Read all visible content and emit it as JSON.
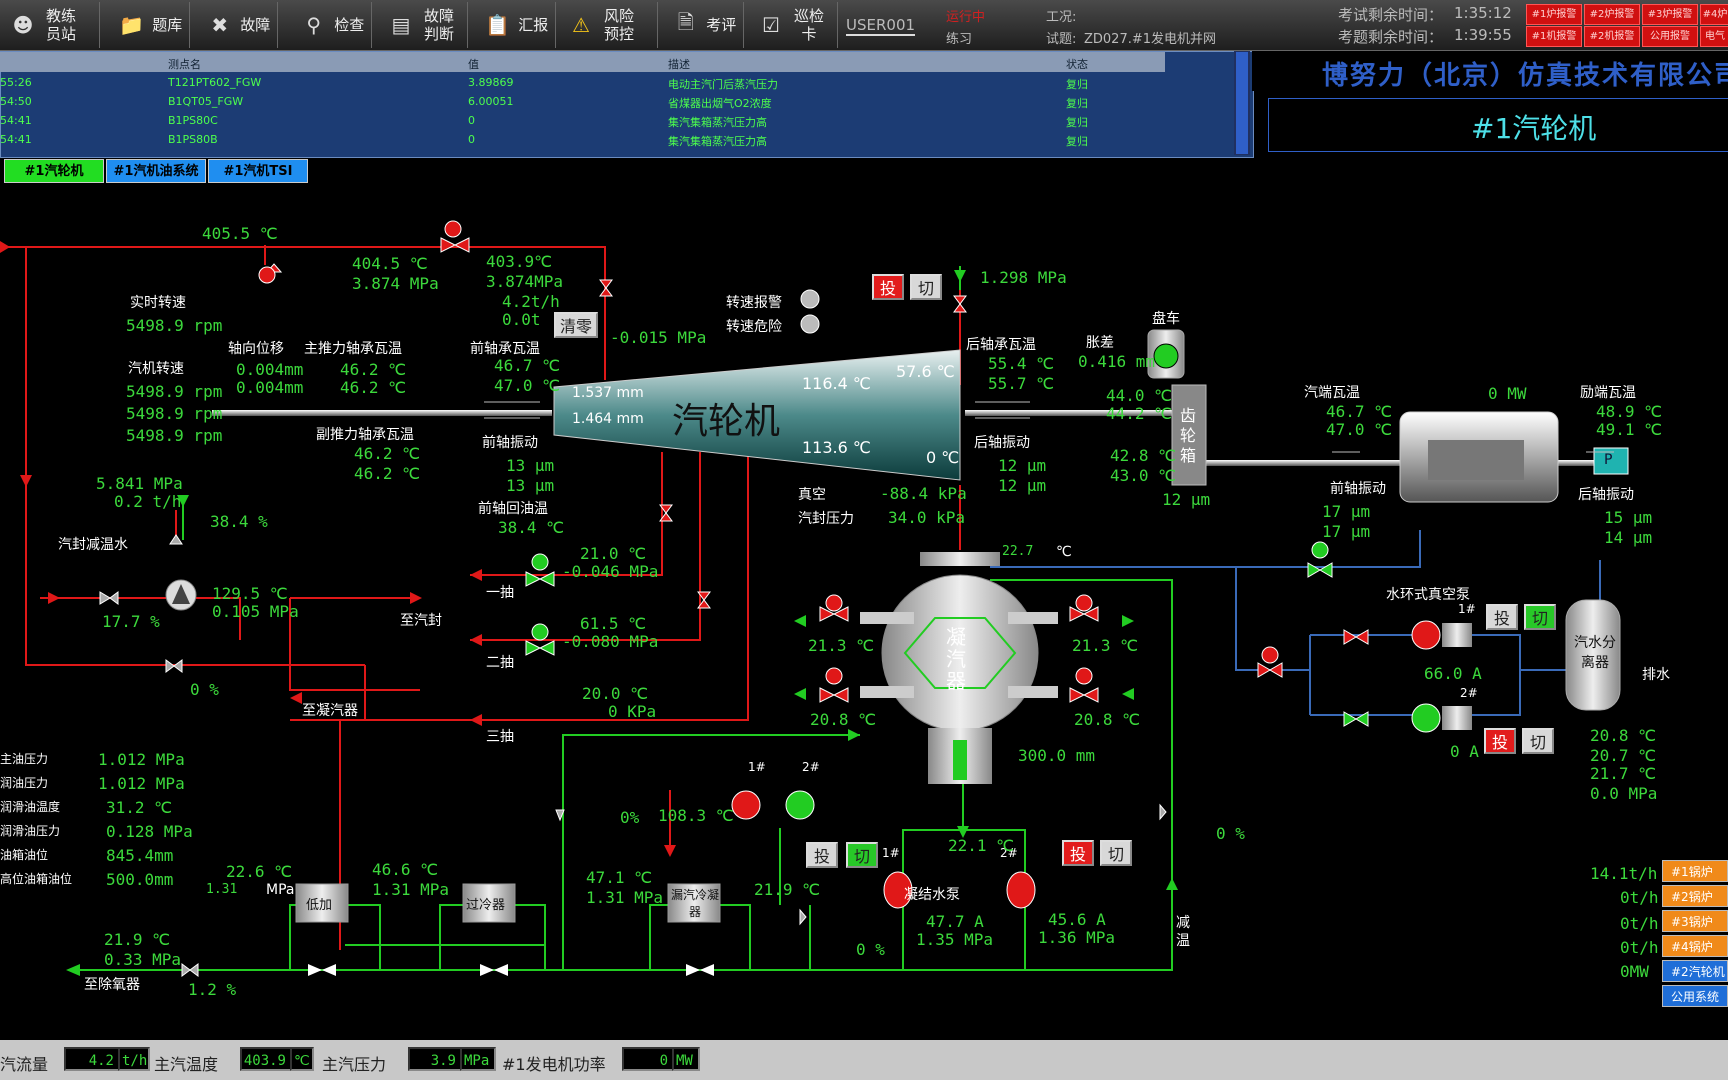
{
  "toolbar": {
    "buttons": [
      {
        "label": "教练员站",
        "icon": "user-icon"
      },
      {
        "label": "题库",
        "icon": "folder-icon"
      },
      {
        "label": "故障",
        "icon": "tools-icon"
      },
      {
        "label": "检查",
        "icon": "magnifier-icon"
      },
      {
        "label": "故障判断",
        "icon": "monitor-icon"
      },
      {
        "label": "汇报",
        "icon": "clipboard-icon"
      },
      {
        "label": "风险预控",
        "icon": "warning-icon"
      },
      {
        "label": "考评",
        "icon": "document-icon"
      },
      {
        "label": "巡检卡",
        "icon": "checklist-icon"
      }
    ],
    "user": "USER001",
    "mode_status": "运行中",
    "mode": "练习",
    "condition_label": "工况:",
    "exam_label": "试题:",
    "exam_name": "ZD027.#1发电机并网",
    "exam_remaining_label": "考试剩余时间：",
    "exam_remaining": "1:35:12",
    "question_remaining_label": "考题剩余时间：",
    "question_remaining": "1:39:55",
    "alarm_buttons": [
      "#1炉报警",
      "#2炉报警",
      "#3炉报警",
      "#4炉",
      "#1机报警",
      "#2机报警",
      "公用报警",
      "电气"
    ]
  },
  "alarm_table": {
    "headers": [
      "测点名",
      "值",
      "描述",
      "状态"
    ],
    "rows": [
      {
        "time": "55:26",
        "point": "T121PT602_FGW",
        "value": "3.89869",
        "desc": "电动主汽门后蒸汽压力",
        "state": "复归"
      },
      {
        "time": "54:50",
        "point": "B1QT05_FGW",
        "value": "6.00051",
        "desc": "省煤器出烟气O2浓度",
        "state": "复归"
      },
      {
        "time": "54:41",
        "point": "B1PS80C",
        "value": "0",
        "desc": "集汽集箱蒸汽压力高",
        "state": "复归"
      },
      {
        "time": "54:41",
        "point": "B1PS80B",
        "value": "0",
        "desc": "集汽集箱蒸汽压力高",
        "state": "复归"
      }
    ]
  },
  "company": "博努力（北京）仿真技术有限公司",
  "page_title": "#1汽轮机",
  "tabs": [
    "#1汽轮机",
    "#1汽机油系统",
    "#1汽机TSI"
  ],
  "main_steam": {
    "temp1": "405.5 ℃",
    "temp2": "404.5  ℃",
    "pressure": "3.874  MPa"
  },
  "steam_in": {
    "temp": "403.9℃",
    "pressure": "3.874MPa",
    "flow": "4.2t/h",
    "total": "0.0t",
    "clear_label": "清零",
    "valve_pressure": "-0.015 MPa"
  },
  "speed": {
    "realtime_label": "实时转速",
    "realtime": "5498.9 rpm",
    "turbine_label": "汽机转速",
    "turbine": [
      "5498.9 rpm",
      "5498.9 rpm",
      "5498.9 rpm"
    ],
    "alarm_label": "转速报警",
    "danger_label": "转速危险"
  },
  "axial": {
    "label": "轴向位移",
    "values": [
      "0.004mm",
      "0.004mm"
    ]
  },
  "main_thrust": {
    "label": "主推力轴承瓦温",
    "values": [
      "46.2 ℃",
      "46.2 ℃"
    ]
  },
  "aux_thrust": {
    "label": "副推力轴承瓦温",
    "values": [
      "46.2 ℃",
      "46.2 ℃"
    ]
  },
  "front_bearing": {
    "label": "前轴承瓦温",
    "values": [
      "46.7 ℃",
      "47.0 ℃"
    ],
    "vib_label": "前轴振动",
    "vib": [
      "13 μm",
      "13 μm"
    ],
    "return_label": "前轴回油温",
    "return": "38.4 ℃"
  },
  "turbine": {
    "name": "汽轮机",
    "inlet_mm": [
      "1.537 mm",
      "1.464 mm"
    ],
    "temp_top": "116.4 ℃",
    "temp_bottom": "113.6 ℃",
    "exhaust_top": "57.6 ℃",
    "exhaust_bottom": "0 ℃"
  },
  "rear_bearing": {
    "label": "后轴承瓦温",
    "values": [
      "55.4 ℃",
      "55.7 ℃"
    ],
    "vib_label": "后轴振动",
    "vib": [
      "12 μm",
      "12 μm"
    ]
  },
  "exhaust_pressure": "1.298 MPa",
  "diff_expansion": {
    "label": "胀差",
    "value": "0.416 mm"
  },
  "turning_gear": {
    "label": "盘车"
  },
  "gearbox": {
    "label": "齿轮箱",
    "temps_top": [
      "44.0 ℃",
      "44.2 ℃"
    ],
    "temps_bottom": [
      "42.8 ℃",
      "43.0 ℃"
    ],
    "vib": "12 μm"
  },
  "generator": {
    "power": "0 MW",
    "bearing_label": "汽端瓦温",
    "bearing": [
      "46.7 ℃",
      "47.0 ℃"
    ],
    "front_vib_label": "前轴振动",
    "front_vib": [
      "17 μm",
      "17 μm"
    ],
    "exciter_label": "励端瓦温",
    "exciter": [
      "48.9 ℃",
      "49.1 ℃"
    ],
    "rear_vib_label": "后轴振动",
    "rear_vib": [
      "15 μm",
      "14 μm"
    ],
    "p_label": "P"
  },
  "vacuum": {
    "label": "真空",
    "value": "-88.4 kPa",
    "seal_label": "汽封压力",
    "seal": "34.0 kPa"
  },
  "condenser": {
    "label": "凝汽器",
    "temp": "22.7",
    "temp_unit": "℃",
    "level": "300.0 mm",
    "cw_left": [
      "21.3 ℃",
      "20.8 ℃"
    ],
    "cw_right": [
      "21.3 ℃",
      "20.8 ℃"
    ]
  },
  "gland": {
    "label": "汽封减温水",
    "pressure": "5.841 MPa",
    "flow": "0.2 t/h",
    "valve_pct": "38.4 %",
    "valve2_pct": "17.7 %",
    "temp": "129.5 ℃",
    "pressure2": "0.105 MPa",
    "to_seal": "至汽封",
    "bypass_pct": "0 %",
    "to_condenser": "至凝汽器"
  },
  "extraction": {
    "first_label": "一抽",
    "first_temp": "21.0 ℃",
    "first_pressure": "-0.046 MPa",
    "second_label": "二抽",
    "second_temp": "61.5 ℃",
    "second_pressure": "-0.080 MPa",
    "third_label": "三抽",
    "third_temp": "20.0 ℃",
    "third_pressure": "0 KPa"
  },
  "oil": {
    "labels": [
      "主油压力",
      "润油压力",
      "润滑油温度",
      "润滑油压力",
      "油箱油位",
      "高位油箱油位"
    ],
    "values": [
      "1.012  MPa",
      "1.012  MPa",
      "31.2  ℃",
      "0.128  MPa",
      "845.4mm",
      "500.0mm"
    ]
  },
  "vacuum_pump": {
    "label": "水环式真空泵",
    "p1": "1#",
    "p2": "2#",
    "current1": "66.0 A",
    "current2": "0 A",
    "separator": "汽水分离器",
    "drain": "排水",
    "temps": [
      "20.8 ℃",
      "20.7 ℃",
      "21.7 ℃",
      "0.0 MPa"
    ]
  },
  "condensate": {
    "label": "凝结水泵",
    "p1": "1#",
    "p2": "2#",
    "temp": "22.1 ℃",
    "current1": "47.7 A",
    "current2": "45.6 A",
    "pressure1": "1.35  MPa",
    "pressure2": "1.36  MPa",
    "min_flow_pct": "0 %",
    "desuper_label": "减温",
    "right_pct": "0 %"
  },
  "fans": {
    "f1": "1#",
    "f2": "2#",
    "temp": "108.3 ℃",
    "valve_pct": "0%"
  },
  "lp_heater": {
    "label": "低加",
    "in_temp": "22.6 ℃",
    "in_pressure_val": "1.31",
    "in_pressure_unit": "MPa",
    "out_temp": "46.6 ℃",
    "out_pressure": "1.31 MPa"
  },
  "cooler": {
    "label": "过冷器"
  },
  "gland_cooler": {
    "label": "漏汽冷凝器",
    "temp": "47.1 ℃",
    "pressure": "1.31 MPa",
    "out_temp": "21.9 ℃"
  },
  "deaerator": {
    "label": "至除氧器",
    "temp": "21.9 ℃",
    "pressure": "0.33 MPa",
    "valve_pct": "1.2 %"
  },
  "buttons": {
    "on": "投",
    "off": "切"
  },
  "boilers": {
    "flows": [
      "14.1t/h",
      "0t/h",
      "0t/h",
      "0t/h",
      "0MW"
    ],
    "labels": [
      "#1锅炉",
      "#2锅炉",
      "#3锅炉",
      "#4锅炉",
      "#2汽轮机",
      "公用系统"
    ]
  },
  "statusbar": {
    "flow_label": "汽流量",
    "flow": "4.2",
    "flow_unit": "t/h",
    "temp_label": "主汽温度",
    "temp": "403.9",
    "temp_unit": "℃",
    "pressure_label": "主汽压力",
    "pressure": "3.9",
    "pressure_unit": "MPa",
    "power_label": "#1发电机功率",
    "power": "0",
    "power_unit": "MW"
  },
  "colors": {
    "value_green": "#3cd93c",
    "pipe_red": "#e01818",
    "pipe_green": "#22cc22",
    "pipe_blue": "#3a6ab8",
    "highlight": "#2f5fc8"
  }
}
